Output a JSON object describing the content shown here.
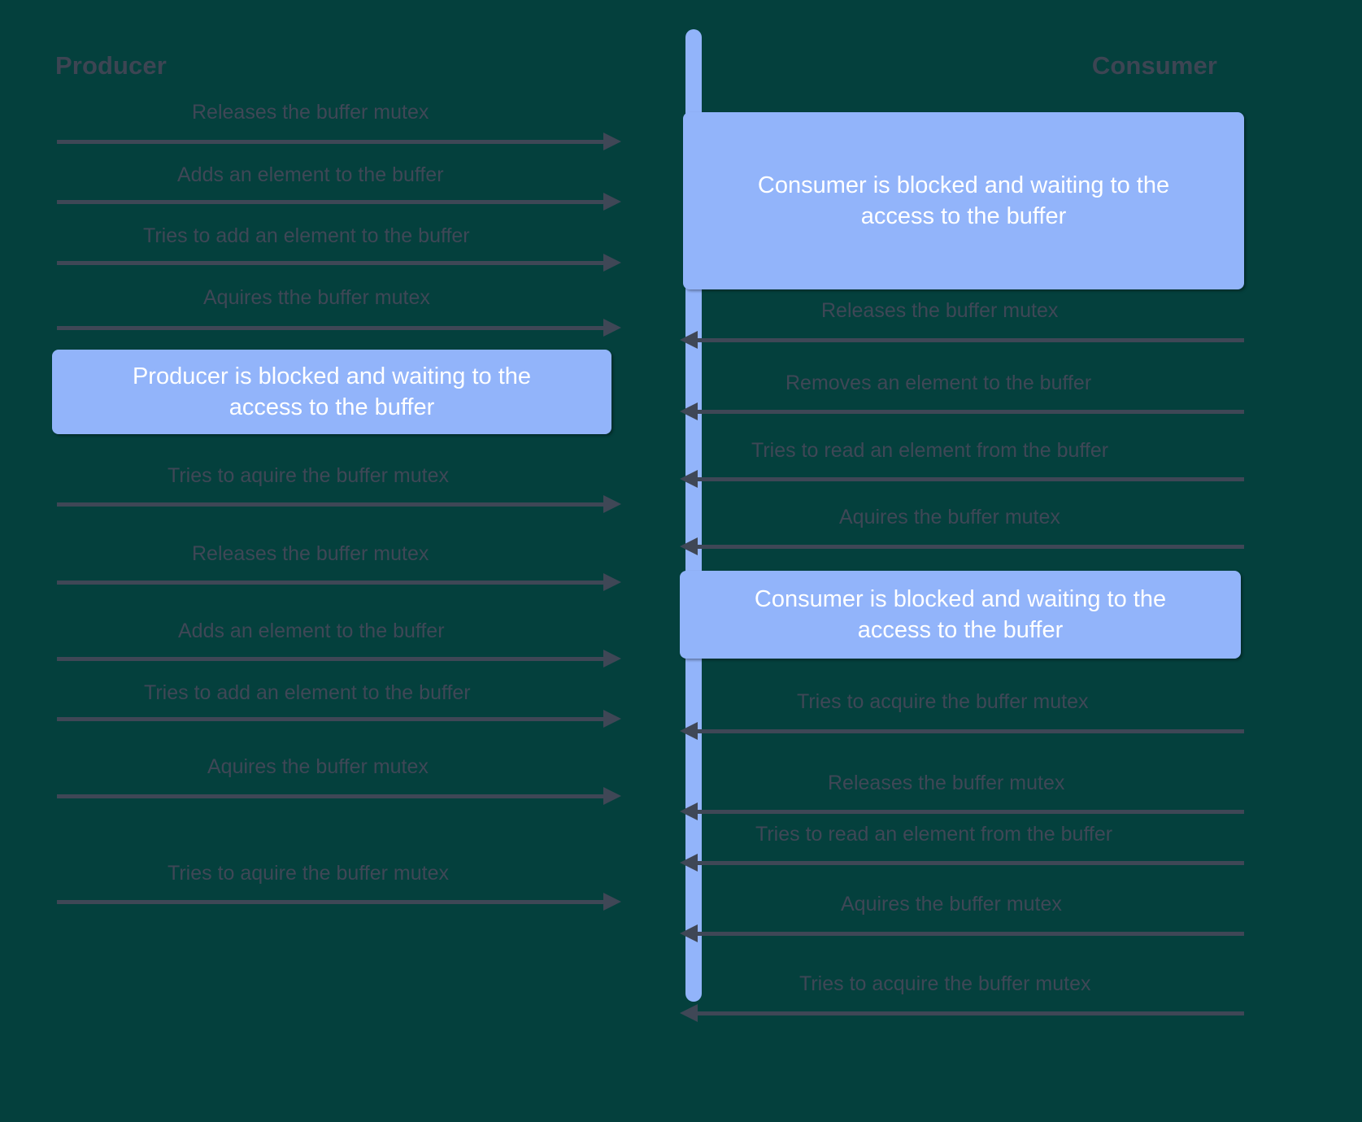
{
  "diagram": {
    "type": "sequence-diagram",
    "background_color": "#04403d",
    "timeline_color": "#92b4fa",
    "arrow_color": "#3f4756",
    "label_color": "#3f4756",
    "box_fill_color": "#92b4fa",
    "box_text_color": "#ffffff",
    "lanes": {
      "left": {
        "title": "Producer"
      },
      "right": {
        "title": "Consumer"
      }
    }
  },
  "producer": {
    "messages": [
      {
        "label": "Releases the buffer mutex",
        "direction": "right"
      },
      {
        "label": "Adds an element to the buffer",
        "direction": "right"
      },
      {
        "label": "Tries to add an element to the buffer",
        "direction": "right"
      },
      {
        "label": "Aquires tthe buffer mutex",
        "direction": "right"
      },
      {
        "label": "Tries to aquire the buffer mutex",
        "direction": "right"
      },
      {
        "label": "Releases the buffer mutex",
        "direction": "right"
      },
      {
        "label": "Adds an element to the buffer",
        "direction": "right"
      },
      {
        "label": "Tries to add an element to the buffer",
        "direction": "right"
      },
      {
        "label": "Aquires the buffer mutex",
        "direction": "right"
      },
      {
        "label": "Tries to aquire the buffer mutex",
        "direction": "right"
      }
    ],
    "blocked_box": {
      "line1": "Producer is blocked and waiting to the",
      "line2": "access to the buffer"
    }
  },
  "consumer": {
    "messages": [
      {
        "label": "Releases the buffer mutex",
        "direction": "left"
      },
      {
        "label": "Removes an element to the buffer",
        "direction": "left"
      },
      {
        "label": "Tries to read an element from the buffer",
        "direction": "left"
      },
      {
        "label": "Aquires the buffer mutex",
        "direction": "left"
      },
      {
        "label": "Tries to acquire the buffer mutex",
        "direction": "left"
      },
      {
        "label": "Releases the buffer mutex",
        "direction": "left"
      },
      {
        "label": "Tries to read an element from the buffer",
        "direction": "left"
      },
      {
        "label": "Aquires the buffer mutex",
        "direction": "left"
      },
      {
        "label": "Tries to acquire the buffer mutex",
        "direction": "left"
      }
    ],
    "blocked_box_top": {
      "line1": "Consumer is blocked and waiting to the",
      "line2": "access to the buffer"
    },
    "blocked_box_mid": {
      "line1": "Consumer is blocked and waiting to the",
      "line2": "access to the buffer"
    }
  }
}
